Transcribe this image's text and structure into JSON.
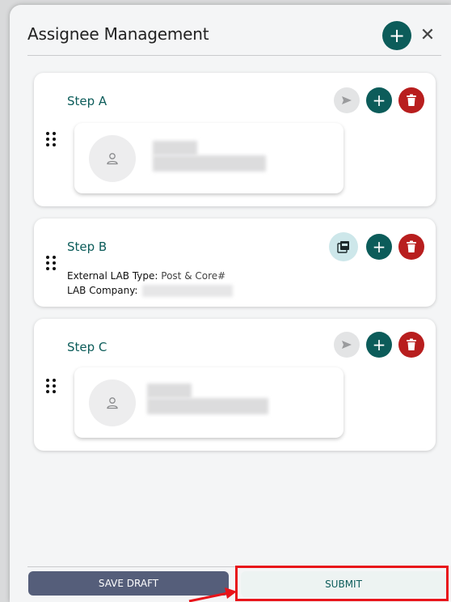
{
  "header": {
    "title": "Assignee Management",
    "add_icon": "plus-icon",
    "close_icon": "close-icon"
  },
  "steps": [
    {
      "title": "Step A",
      "actions": [
        "send-icon",
        "plus-icon",
        "trash-icon"
      ],
      "assignee_avatar_icon": "person-icon"
    },
    {
      "title": "Step B",
      "actions": [
        "pdf-icon",
        "plus-icon",
        "trash-icon"
      ],
      "fields": [
        {
          "label": "External LAB Type:",
          "value": "Post & Core#"
        },
        {
          "label": "LAB Company:",
          "value": ""
        }
      ]
    },
    {
      "title": "Step C",
      "actions": [
        "send-icon",
        "plus-icon",
        "trash-icon"
      ],
      "assignee_avatar_icon": "person-icon"
    }
  ],
  "footer": {
    "save_draft_label": "SAVE DRAFT",
    "submit_label": "SUBMIT"
  },
  "colors": {
    "primary": "#0c5c5a",
    "danger": "#b81e1e",
    "draft_button": "#555e7a",
    "highlight": "#e8141a"
  }
}
